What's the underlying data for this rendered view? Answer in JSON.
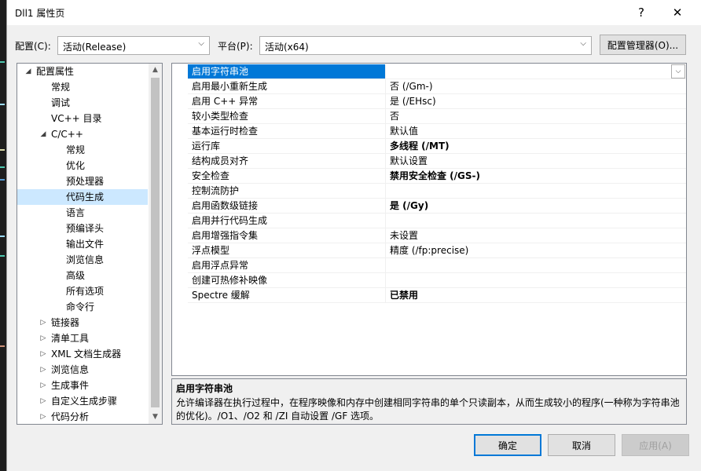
{
  "window": {
    "title": "Dll1 属性页",
    "help_glyph": "?",
    "close_glyph": "✕"
  },
  "config": {
    "label": "配置(C):",
    "value": "活动(Release)",
    "platform_label": "平台(P):",
    "platform_value": "活动(x64)",
    "manager_button": "配置管理器(O)..."
  },
  "tree": [
    {
      "label": "配置属性",
      "level": 0,
      "expander": "◢",
      "selected": false
    },
    {
      "label": "常规",
      "level": 1,
      "expander": "",
      "selected": false
    },
    {
      "label": "调试",
      "level": 1,
      "expander": "",
      "selected": false
    },
    {
      "label": "VC++ 目录",
      "level": 1,
      "expander": "",
      "selected": false
    },
    {
      "label": "C/C++",
      "level": 1,
      "expander": "◢",
      "selected": false
    },
    {
      "label": "常规",
      "level": 2,
      "expander": "",
      "selected": false
    },
    {
      "label": "优化",
      "level": 2,
      "expander": "",
      "selected": false
    },
    {
      "label": "预处理器",
      "level": 2,
      "expander": "",
      "selected": false
    },
    {
      "label": "代码生成",
      "level": 2,
      "expander": "",
      "selected": true
    },
    {
      "label": "语言",
      "level": 2,
      "expander": "",
      "selected": false
    },
    {
      "label": "预编译头",
      "level": 2,
      "expander": "",
      "selected": false
    },
    {
      "label": "输出文件",
      "level": 2,
      "expander": "",
      "selected": false
    },
    {
      "label": "浏览信息",
      "level": 2,
      "expander": "",
      "selected": false
    },
    {
      "label": "高级",
      "level": 2,
      "expander": "",
      "selected": false
    },
    {
      "label": "所有选项",
      "level": 2,
      "expander": "",
      "selected": false
    },
    {
      "label": "命令行",
      "level": 2,
      "expander": "",
      "selected": false
    },
    {
      "label": "链接器",
      "level": 1,
      "expander": "▷",
      "selected": false
    },
    {
      "label": "清单工具",
      "level": 1,
      "expander": "▷",
      "selected": false
    },
    {
      "label": "XML 文档生成器",
      "level": 1,
      "expander": "▷",
      "selected": false
    },
    {
      "label": "浏览信息",
      "level": 1,
      "expander": "▷",
      "selected": false
    },
    {
      "label": "生成事件",
      "level": 1,
      "expander": "▷",
      "selected": false
    },
    {
      "label": "自定义生成步骤",
      "level": 1,
      "expander": "▷",
      "selected": false
    },
    {
      "label": "代码分析",
      "level": 1,
      "expander": "▷",
      "selected": false
    }
  ],
  "properties": [
    {
      "name": "启用字符串池",
      "value": "",
      "bold": false,
      "selected": true
    },
    {
      "name": "启用最小重新生成",
      "value": "否 (/Gm-)",
      "bold": false,
      "selected": false
    },
    {
      "name": "启用 C++ 异常",
      "value": "是 (/EHsc)",
      "bold": false,
      "selected": false
    },
    {
      "name": "较小类型检查",
      "value": "否",
      "bold": false,
      "selected": false
    },
    {
      "name": "基本运行时检查",
      "value": "默认值",
      "bold": false,
      "selected": false
    },
    {
      "name": "运行库",
      "value": "多线程 (/MT)",
      "bold": true,
      "selected": false
    },
    {
      "name": "结构成员对齐",
      "value": "默认设置",
      "bold": false,
      "selected": false
    },
    {
      "name": "安全检查",
      "value": "禁用安全检查 (/GS-)",
      "bold": true,
      "selected": false
    },
    {
      "name": "控制流防护",
      "value": "",
      "bold": false,
      "selected": false
    },
    {
      "name": "启用函数级链接",
      "value": "是 (/Gy)",
      "bold": true,
      "selected": false
    },
    {
      "name": "启用并行代码生成",
      "value": "",
      "bold": false,
      "selected": false
    },
    {
      "name": "启用增强指令集",
      "value": "未设置",
      "bold": false,
      "selected": false
    },
    {
      "name": "浮点模型",
      "value": "精度 (/fp:precise)",
      "bold": false,
      "selected": false
    },
    {
      "name": "启用浮点异常",
      "value": "",
      "bold": false,
      "selected": false
    },
    {
      "name": "创建可热修补映像",
      "value": "",
      "bold": false,
      "selected": false
    },
    {
      "name": "Spectre 缓解",
      "value": "已禁用",
      "bold": true,
      "selected": false
    }
  ],
  "description": {
    "title": "启用字符串池",
    "text": "允许编译器在执行过程中，在程序映像和内存中创建相同字符串的单个只读副本，从而生成较小的程序(一种称为字符串池的优化)。/O1、/O2 和 /ZI 自动设置 /GF 选项。"
  },
  "buttons": {
    "ok": "确定",
    "cancel": "取消",
    "apply": "应用(A)"
  },
  "icons": {
    "combo_arrow": "⌵",
    "scroll_up": "▲",
    "scroll_down": "▼"
  },
  "colors": {
    "accent": "#0078d7",
    "selection": "#cce8ff"
  }
}
